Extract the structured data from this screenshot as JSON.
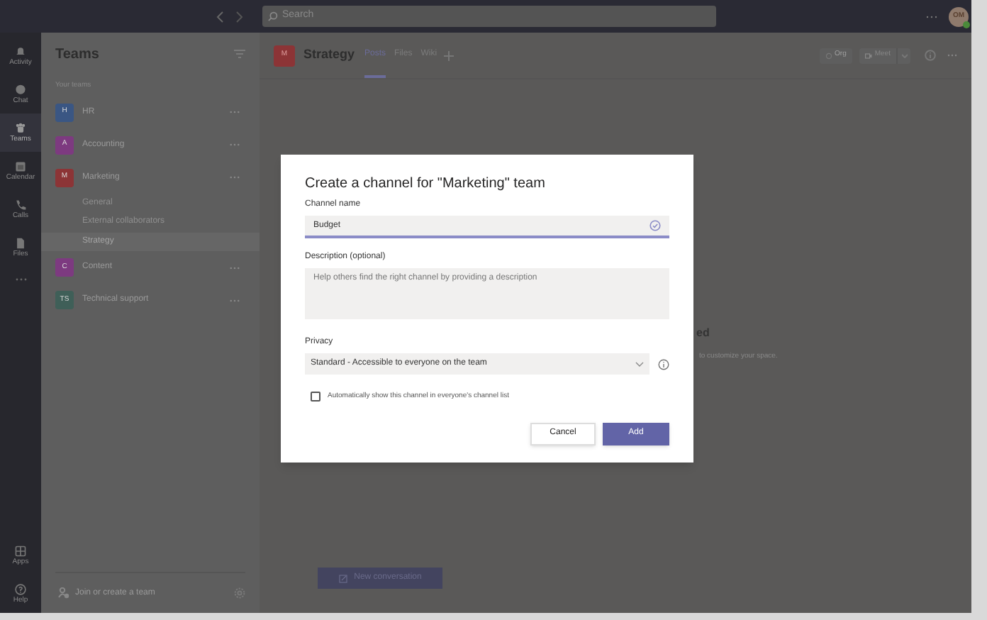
{
  "search": {
    "placeholder": "Search"
  },
  "user": {
    "initials": "OM"
  },
  "rail": [
    {
      "label": "Activity",
      "selected": false
    },
    {
      "label": "Chat",
      "selected": false
    },
    {
      "label": "Teams",
      "selected": true
    },
    {
      "label": "Calendar",
      "selected": false
    },
    {
      "label": "Calls",
      "selected": false
    },
    {
      "label": "Files",
      "selected": false
    },
    {
      "label": "Apps",
      "selected": false
    },
    {
      "label": "Help",
      "selected": false
    }
  ],
  "sidebar": {
    "title": "Teams",
    "section": "Your teams",
    "teams": [
      {
        "name": "HR",
        "initial": "H",
        "color": "#3a5683"
      },
      {
        "name": "Accounting",
        "initial": "A",
        "color": "#7d3a80"
      },
      {
        "name": "Marketing",
        "initial": "M",
        "color": "#8c3436",
        "children": [
          {
            "name": "General",
            "selected": false
          },
          {
            "name": "External collaborators",
            "selected": false
          },
          {
            "name": "Strategy",
            "selected": true
          }
        ]
      },
      {
        "name": "Content",
        "initial": "C",
        "color": "#7d3a80"
      },
      {
        "name": "Technical support",
        "initial": "TS",
        "color": "#3f5f58"
      }
    ],
    "footer": "Join or create a team"
  },
  "channel": {
    "initial": "M",
    "name": "Strategy",
    "tabs": [
      {
        "label": "Posts",
        "selected": true
      },
      {
        "label": "Files",
        "selected": false
      },
      {
        "label": "Wiki",
        "selected": false
      }
    ],
    "actions": [
      "Org",
      "Meet"
    ],
    "behind_heading": "ed",
    "behind_text": "to customize your space.",
    "new_conversation": "New conversation"
  },
  "dialog": {
    "title": "Create a channel for \"Marketing\" team",
    "name_label": "Channel name",
    "name_value": "Budget",
    "description_label": "Description (optional)",
    "description_placeholder": "Help others find the right channel by providing a description",
    "privacy_label": "Privacy",
    "privacy_value": "Standard - Accessible to everyone on the team",
    "auto_show": {
      "label": "Automatically show this channel in everyone's channel list",
      "checked": false
    },
    "buttons": [
      "Cancel",
      "Add"
    ]
  }
}
